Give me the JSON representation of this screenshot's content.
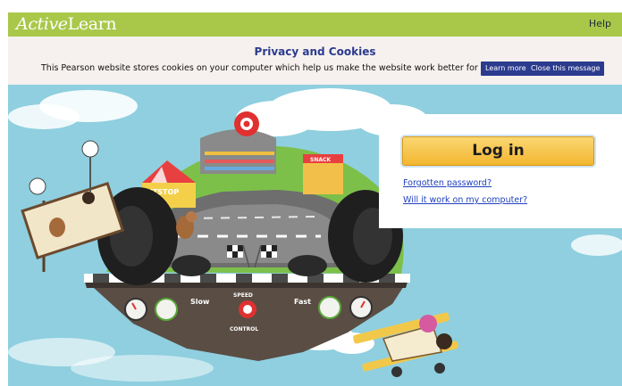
{
  "header": {
    "brand_active": "Active",
    "brand_learn": "Learn",
    "help_label": "Help"
  },
  "cookie_banner": {
    "title": "Privacy and Cookies",
    "message": "This Pearson website stores cookies on your computer which help us make the website work better for you.",
    "learn_more_label": "Learn more",
    "close_label": "Close this message"
  },
  "login_panel": {
    "login_label": "Log in",
    "forgot_password_label": "Forgotten password?",
    "compat_label": "Will it work on my computer?"
  },
  "scene": {
    "pitstop_sign": "PITSTOP",
    "snack_sign": "SNACK",
    "slow_label": "Slow",
    "fast_label": "Fast",
    "speed_label": "SPEED",
    "control_label": "CONTROL"
  },
  "colors": {
    "header_green": "#a9c84a",
    "banner_bg": "#f6f1ee",
    "banner_title": "#2b3b8e",
    "sky": "#8fcfdf",
    "login_yellow": "#f3b630",
    "link_blue": "#1f3fbd"
  }
}
